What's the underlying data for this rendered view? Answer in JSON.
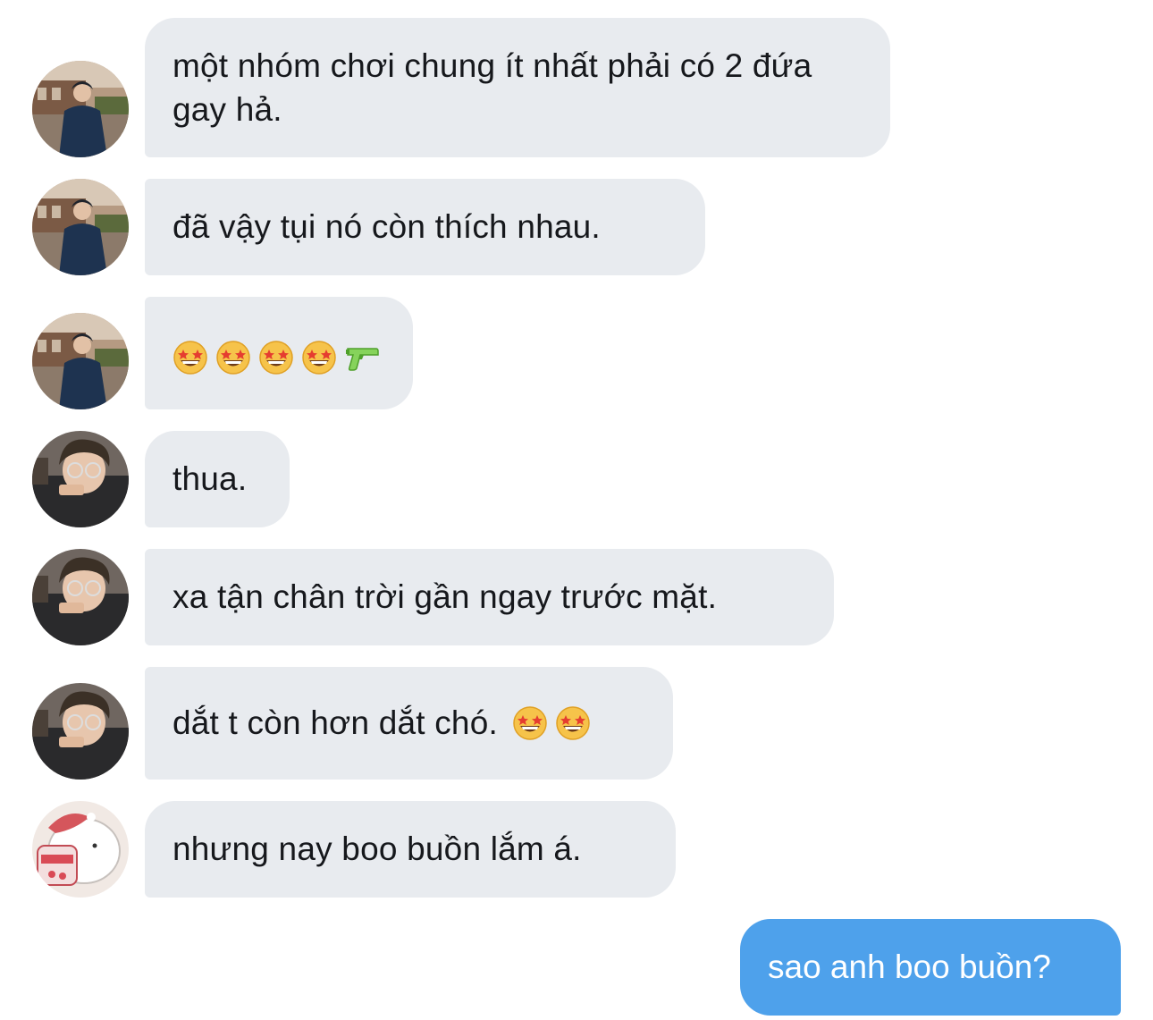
{
  "conversation": {
    "messages": [
      {
        "sender": "avatar-a",
        "text": "một nhóm chơi chung ít nhất phải có 2 đứa gay hả."
      },
      {
        "sender": "avatar-a",
        "text": "đã vậy tụi nó còn thích nhau."
      },
      {
        "sender": "avatar-a",
        "emojis": [
          "star-struck",
          "star-struck",
          "star-struck",
          "star-struck",
          "water-pistol"
        ]
      },
      {
        "sender": "avatar-b",
        "text": "thua."
      },
      {
        "sender": "avatar-b",
        "text": "xa tận chân trời gần ngay trước mặt."
      },
      {
        "sender": "avatar-b",
        "text": "dắt t còn hơn dắt chó.",
        "emojis": [
          "star-struck",
          "star-struck"
        ]
      },
      {
        "sender": "avatar-c",
        "text": "nhưng nay boo buồn lắm á."
      },
      {
        "sender": "me",
        "text": "sao anh boo buồn?"
      }
    ]
  },
  "colors": {
    "incoming_bubble": "#e8ebef",
    "outgoing_bubble": "#4ea1eb",
    "text_dark": "#16181c",
    "text_light": "#ffffff"
  }
}
